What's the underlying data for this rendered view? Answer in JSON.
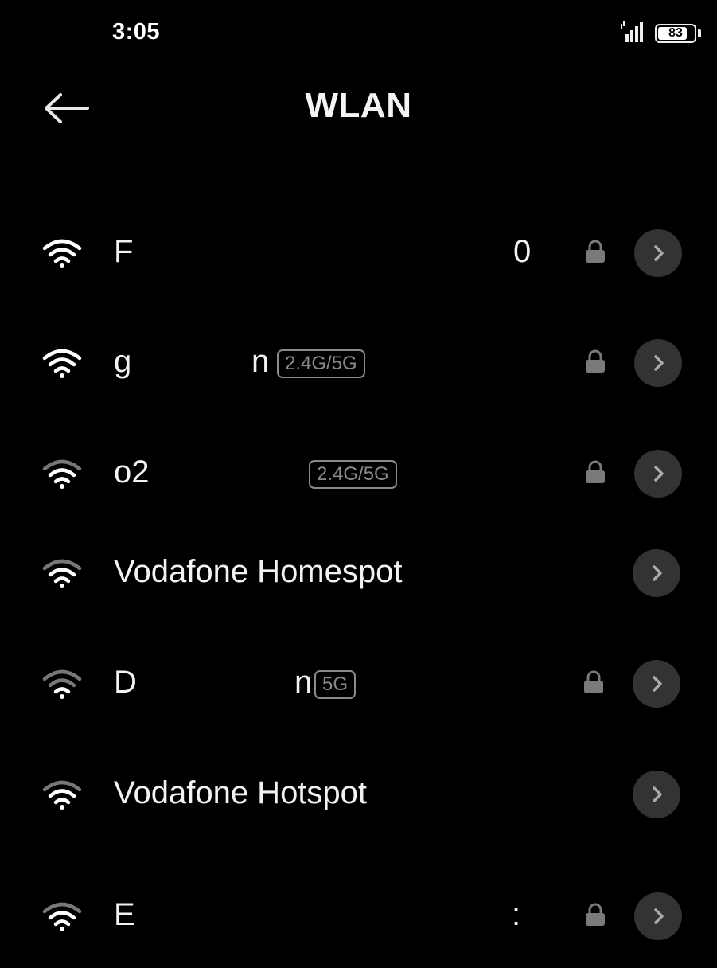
{
  "status_bar": {
    "time": "3:05",
    "battery": "83",
    "battery_level": 0.83
  },
  "header": {
    "title": "WLAN"
  },
  "networks": [
    {
      "name": "F",
      "suffix": "0",
      "badge": "",
      "locked": true,
      "strength": "full"
    },
    {
      "name": "g",
      "suffix": "n",
      "badge": "2.4G/5G",
      "locked": true,
      "strength": "full"
    },
    {
      "name": "o2",
      "suffix": "",
      "badge": "2.4G/5G",
      "locked": true,
      "strength": "medium"
    },
    {
      "name": "Vodafone Homespot",
      "suffix": "",
      "badge": "",
      "locked": false,
      "strength": "medium"
    },
    {
      "name": "D",
      "suffix": "n",
      "badge": "5G",
      "locked": true,
      "strength": "low"
    },
    {
      "name": "Vodafone Hotspot",
      "suffix": "",
      "badge": "",
      "locked": false,
      "strength": "medium"
    },
    {
      "name": "E",
      "suffix": ":",
      "badge": "",
      "locked": true,
      "strength": "medium"
    }
  ],
  "colors": {
    "background": "#000000",
    "text": "#f2f2f2",
    "muted": "#8a8a8a",
    "button": "#333333"
  },
  "icons": {
    "back": "arrow-left-icon",
    "wifi": "wifi-icon",
    "lock": "lock-icon",
    "detail": "chevron-right-icon",
    "signal": "cellular-signal-icon",
    "battery": "battery-icon"
  }
}
